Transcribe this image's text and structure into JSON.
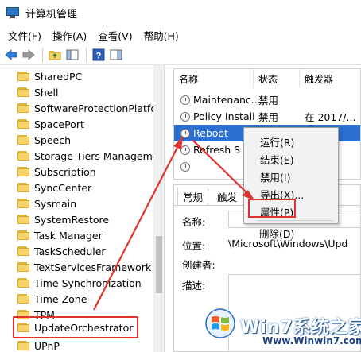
{
  "window": {
    "title": "计算机管理"
  },
  "menubar": [
    "文件(F)",
    "操作(A)",
    "查看(V)",
    "帮助(H)"
  ],
  "toolbar": {
    "icons": [
      "back-arrow-icon",
      "forward-arrow-icon",
      "up-folder-icon",
      "show-hide-tree-icon",
      "help-icon",
      "action-pane-icon"
    ]
  },
  "tree": {
    "items": [
      "SharedPC",
      "Shell",
      "SoftwareProtectionPlatfor",
      "SpacePort",
      "Speech",
      "Storage Tiers Manageme",
      "Subscription",
      "SyncCenter",
      "Sysmain",
      "SystemRestore",
      "Task Manager",
      "TaskScheduler",
      "TextServicesFramework",
      "Time Synchronization",
      "Time Zone",
      "TPM",
      "UpdateOrchestrator",
      "UPnP"
    ],
    "highlighted": "UpdateOrchestrator"
  },
  "task_list": {
    "columns": [
      "名称",
      "状态",
      "触发器"
    ],
    "rows": [
      {
        "name": "Maintenanc...",
        "status": "禁用",
        "trigger": ""
      },
      {
        "name": "Policy Install",
        "status": "禁用",
        "trigger": "在 2017/..."
      },
      {
        "name": "Reboot",
        "status": "",
        "trigger": "",
        "selected": true
      },
      {
        "name": "Refresh S",
        "status": "",
        "trigger": ""
      },
      {
        "name": "",
        "status": "",
        "trigger": ""
      }
    ]
  },
  "detail": {
    "tabs": [
      "常规",
      "触发"
    ],
    "fields": {
      "name_label": "名称:",
      "location_label": "位置:",
      "location_value": "\\Microsoft\\Windows\\Upd",
      "author_label": "创建者:",
      "description_label": "描述:"
    }
  },
  "context_menu": {
    "items": [
      "运行(R)",
      "结束(E)",
      "禁用(I)",
      "导出(X)...",
      "属性(P)",
      "删除(D)"
    ],
    "highlighted": "属性(P)"
  },
  "watermark": {
    "brand": "Win7系统之家",
    "url": "Www.Winwin7.com"
  },
  "colors": {
    "selection": "#2b6fd0",
    "annotation_red": "#e0332f",
    "folder_yellow": "#f6d36b"
  }
}
